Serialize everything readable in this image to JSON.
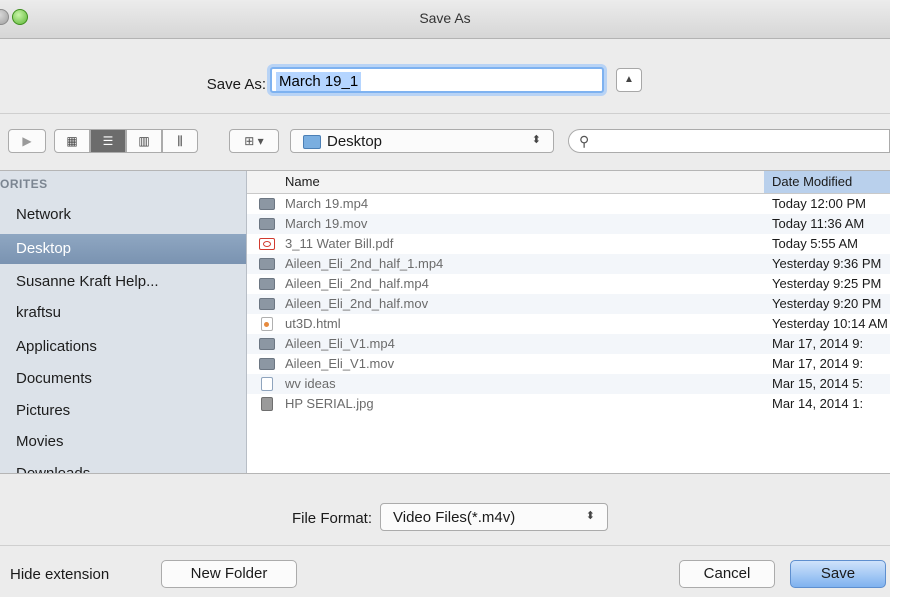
{
  "window": {
    "title": "Save As"
  },
  "save_as": {
    "label": "Save As:",
    "value": "March 19_1",
    "expand_glyph": "▲"
  },
  "toolbar": {
    "forward_glyph": "▶",
    "view_glyphs": [
      "▦",
      "☰",
      "▥",
      "⫼"
    ],
    "arrange_glyph": "⊞ ▾",
    "location": "Desktop",
    "location_arrows": "⬍",
    "search_glyph": "⚲"
  },
  "sidebar": {
    "heading": "ORITES",
    "items": [
      {
        "label": "Network"
      },
      {
        "label": "Desktop"
      },
      {
        "label": "Susanne Kraft Help..."
      },
      {
        "label": "kraftsu"
      },
      {
        "label": "Applications"
      },
      {
        "label": "Documents"
      },
      {
        "label": "Pictures"
      },
      {
        "label": "Movies"
      },
      {
        "label": "Downloads"
      }
    ]
  },
  "files": {
    "header_name": "Name",
    "header_date": "Date Modified",
    "rows": [
      {
        "name": "March 19.mp4",
        "date": "Today 12:00 PM",
        "icon": "video-file-icon"
      },
      {
        "name": "March 19.mov",
        "date": "Today 11:36 AM",
        "icon": "video-file-icon"
      },
      {
        "name": "3_11 Water Bill.pdf",
        "date": "Today 5:55 AM",
        "icon": "pdf-file-icon"
      },
      {
        "name": "Aileen_Eli_2nd_half_1.mp4",
        "date": "Yesterday 9:36 PM",
        "icon": "video-file-icon"
      },
      {
        "name": "Aileen_Eli_2nd_half.mp4",
        "date": "Yesterday 9:25 PM",
        "icon": "video-file-icon"
      },
      {
        "name": "Aileen_Eli_2nd_half.mov",
        "date": "Yesterday 9:20 PM",
        "icon": "video-file-icon"
      },
      {
        "name": "ut3D.html",
        "date": "Yesterday 10:14 AM",
        "icon": "html-file-icon"
      },
      {
        "name": "Aileen_Eli_V1.mp4",
        "date": "Mar 17, 2014 9:",
        "icon": "video-file-icon"
      },
      {
        "name": "Aileen_Eli_V1.mov",
        "date": "Mar 17, 2014 9:",
        "icon": "video-file-icon"
      },
      {
        "name": "wv ideas",
        "date": "Mar 15, 2014 5:",
        "icon": "text-file-icon"
      },
      {
        "name": "HP SERIAL.jpg",
        "date": "Mar 14, 2014 1:",
        "icon": "image-file-icon"
      }
    ]
  },
  "file_format": {
    "label": "File Format:",
    "value": "Video Files(*.m4v)",
    "arrows": "⬍"
  },
  "bottom": {
    "hide_extension": "Hide extension",
    "new_folder": "New Folder",
    "cancel": "Cancel",
    "save": "Save"
  }
}
